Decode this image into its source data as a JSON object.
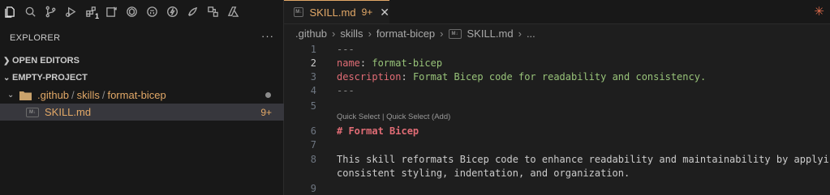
{
  "activity_bar": {
    "icons": [
      "files-icon",
      "search-icon",
      "source-control-icon",
      "run-debug-icon",
      "extensions-icon",
      "remote-explorer-icon",
      "chatgpt-icon",
      "github-icon",
      "lightning-icon",
      "rocket-icon",
      "shapes-icon",
      "azure-icon"
    ],
    "extensions_count": "1"
  },
  "sidebar": {
    "title": "EXPLORER",
    "more": "···",
    "open_editors": "OPEN EDITORS",
    "project": "EMPTY-PROJECT",
    "folder_parts": [
      ".github",
      "skills",
      "format-bicep"
    ],
    "file_badge": "M↓",
    "file_name": "SKILL.md",
    "file_count": "9+"
  },
  "tab": {
    "badge": "M↓",
    "name": "SKILL.md",
    "modified": "9+",
    "close": "✕"
  },
  "breadcrumb": [
    ".github",
    "skills",
    "format-bicep",
    "SKILL.md",
    "..."
  ],
  "editor": {
    "codelens": "Quick Select | Quick Select (Add)",
    "lines": [
      {
        "n": "1",
        "text": "---"
      },
      {
        "n": "2",
        "key": "name",
        "value": "format-bicep"
      },
      {
        "n": "3",
        "key": "description",
        "value": "Format Bicep code for readability and consistency."
      },
      {
        "n": "4",
        "text": "---"
      },
      {
        "n": "5",
        "text": ""
      },
      {
        "n": "6",
        "text": "# Format Bicep"
      },
      {
        "n": "7",
        "text": ""
      },
      {
        "n": "8",
        "text": "This skill reformats Bicep code to enhance readability and maintainability by applying"
      },
      {
        "n": "",
        "text": "consistent styling, indentation, and organization."
      },
      {
        "n": "9",
        "text": ""
      }
    ]
  },
  "colors": {
    "accent": "#e2a867",
    "key": "#e06c75",
    "value": "#98c379"
  }
}
